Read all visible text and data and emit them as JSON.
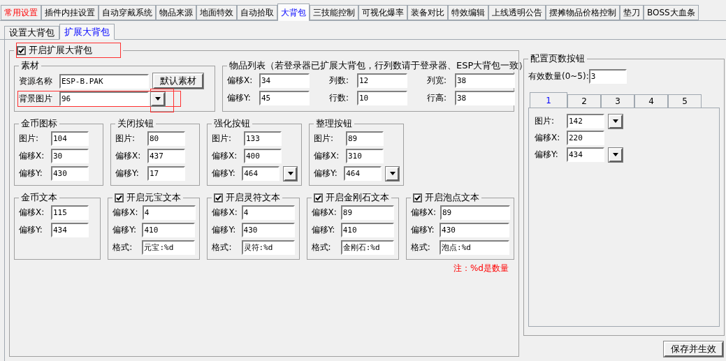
{
  "main_tabs": [
    {
      "label": "常用设置",
      "kind": "warning",
      "selected": false
    },
    {
      "label": "插件内挂设置",
      "kind": "normal",
      "selected": false
    },
    {
      "label": "自动穿戴系统",
      "kind": "normal",
      "selected": false
    },
    {
      "label": "物品来源",
      "kind": "normal",
      "selected": false
    },
    {
      "label": "地面特效",
      "kind": "normal",
      "selected": false
    },
    {
      "label": "自动拾取",
      "kind": "normal",
      "selected": false
    },
    {
      "label": "大背包",
      "kind": "normal",
      "selected": true
    },
    {
      "label": "三技能控制",
      "kind": "normal",
      "selected": false
    },
    {
      "label": "可视化爆率",
      "kind": "normal",
      "selected": false
    },
    {
      "label": "装备对比",
      "kind": "normal",
      "selected": false
    },
    {
      "label": "特效编辑",
      "kind": "normal",
      "selected": false
    },
    {
      "label": "上线透明公告",
      "kind": "normal",
      "selected": false
    },
    {
      "label": "摆摊物品价格控制",
      "kind": "normal",
      "selected": false
    },
    {
      "label": "垫刀",
      "kind": "normal",
      "selected": false
    },
    {
      "label": "BOSS大血条",
      "kind": "normal",
      "selected": false
    }
  ],
  "sub_tabs": [
    {
      "label": "设置大背包",
      "selected": false
    },
    {
      "label": "扩展大背包",
      "selected": true
    }
  ],
  "enable": {
    "label": "开启扩展大背包",
    "checked": true
  },
  "material": {
    "title": "素材",
    "resource_label": "资源名称",
    "resource_value": "ESP-B.PAK",
    "default_button": "默认素材",
    "background_label": "背景图片",
    "background_value": "96"
  },
  "item_list": {
    "title": "物品列表（若登录器已扩展大背包，行列数请于登录器、ESP大背包一致）",
    "fields": [
      {
        "label": "偏移X:",
        "value": "34"
      },
      {
        "label": "列数:",
        "value": "12"
      },
      {
        "label": "列宽:",
        "value": "38"
      },
      {
        "label": "偏移Y:",
        "value": "45"
      },
      {
        "label": "行数:",
        "value": "10"
      },
      {
        "label": "行高:",
        "value": "38"
      }
    ]
  },
  "icon_groups": [
    {
      "kind": "plain",
      "title": "金币图标",
      "fields": [
        {
          "label": "图片:",
          "value": "104",
          "kind": "text"
        },
        {
          "label": "偏移X:",
          "value": "30",
          "kind": "text"
        },
        {
          "label": "偏移Y:",
          "value": "430",
          "kind": "text"
        }
      ]
    },
    {
      "kind": "plain",
      "title": "关闭按钮",
      "fields": [
        {
          "label": "图片:",
          "value": "80",
          "kind": "text"
        },
        {
          "label": "偏移X:",
          "value": "437",
          "kind": "text"
        },
        {
          "label": "偏移Y:",
          "value": "17",
          "kind": "text"
        }
      ]
    },
    {
      "kind": "plain",
      "title": "强化按钮",
      "fields": [
        {
          "label": "图片:",
          "value": "133",
          "kind": "text"
        },
        {
          "label": "偏移X:",
          "value": "400",
          "kind": "text"
        },
        {
          "label": "偏移Y:",
          "value": "464",
          "kind": "combo"
        }
      ]
    },
    {
      "kind": "plain",
      "title": "整理按钮",
      "fields": [
        {
          "label": "图片:",
          "value": "89",
          "kind": "text"
        },
        {
          "label": "偏移X:",
          "value": "310",
          "kind": "text"
        },
        {
          "label": "偏移Y:",
          "value": "464",
          "kind": "combo"
        }
      ]
    }
  ],
  "text_groups": [
    {
      "kind": "plain",
      "title": "金币文本",
      "fields": [
        {
          "label": "偏移X:",
          "value": "115",
          "kind": "text"
        },
        {
          "label": "偏移Y:",
          "value": "434",
          "kind": "text"
        }
      ]
    },
    {
      "kind": "checkbox",
      "title": "开启元宝文本",
      "checked": true,
      "fields": [
        {
          "label": "偏移X:",
          "value": "4",
          "kind": "text"
        },
        {
          "label": "偏移Y:",
          "value": "410",
          "kind": "text"
        },
        {
          "label": "格式:",
          "value": "元宝:%d",
          "kind": "text"
        }
      ]
    },
    {
      "kind": "checkbox",
      "title": "开启灵符文本",
      "checked": true,
      "fields": [
        {
          "label": "偏移X:",
          "value": "4",
          "kind": "text"
        },
        {
          "label": "偏移Y:",
          "value": "430",
          "kind": "text"
        },
        {
          "label": "格式:",
          "value": "灵符:%d",
          "kind": "text"
        }
      ]
    },
    {
      "kind": "checkbox",
      "title": "开启金刚石文本",
      "checked": true,
      "fields": [
        {
          "label": "偏移X:",
          "value": "89",
          "kind": "text"
        },
        {
          "label": "偏移Y:",
          "value": "410",
          "kind": "text"
        },
        {
          "label": "格式:",
          "value": "金刚石:%d",
          "kind": "text"
        }
      ]
    },
    {
      "kind": "checkbox",
      "title": "开启泡点文本",
      "checked": true,
      "fields": [
        {
          "label": "偏移X:",
          "value": "89",
          "kind": "text"
        },
        {
          "label": "偏移Y:",
          "value": "430",
          "kind": "text"
        },
        {
          "label": "格式:",
          "value": "泡点:%d",
          "kind": "text"
        }
      ]
    }
  ],
  "note": "注：%d是数量",
  "page_buttons": {
    "title": "配置页数按钮",
    "count_label": "有效数量(0~5):",
    "count_value": "3",
    "tabs": [
      {
        "label": "1",
        "selected": true
      },
      {
        "label": "2",
        "selected": false
      },
      {
        "label": "3",
        "selected": false
      },
      {
        "label": "4",
        "selected": false
      },
      {
        "label": "5",
        "selected": false
      }
    ],
    "fields": [
      {
        "label": "图片:",
        "value": "142",
        "kind": "combo"
      },
      {
        "label": "偏移X:",
        "value": "220",
        "kind": "text"
      },
      {
        "label": "偏移Y:",
        "value": "434",
        "kind": "combo"
      }
    ]
  },
  "save_button": "保存并生效"
}
